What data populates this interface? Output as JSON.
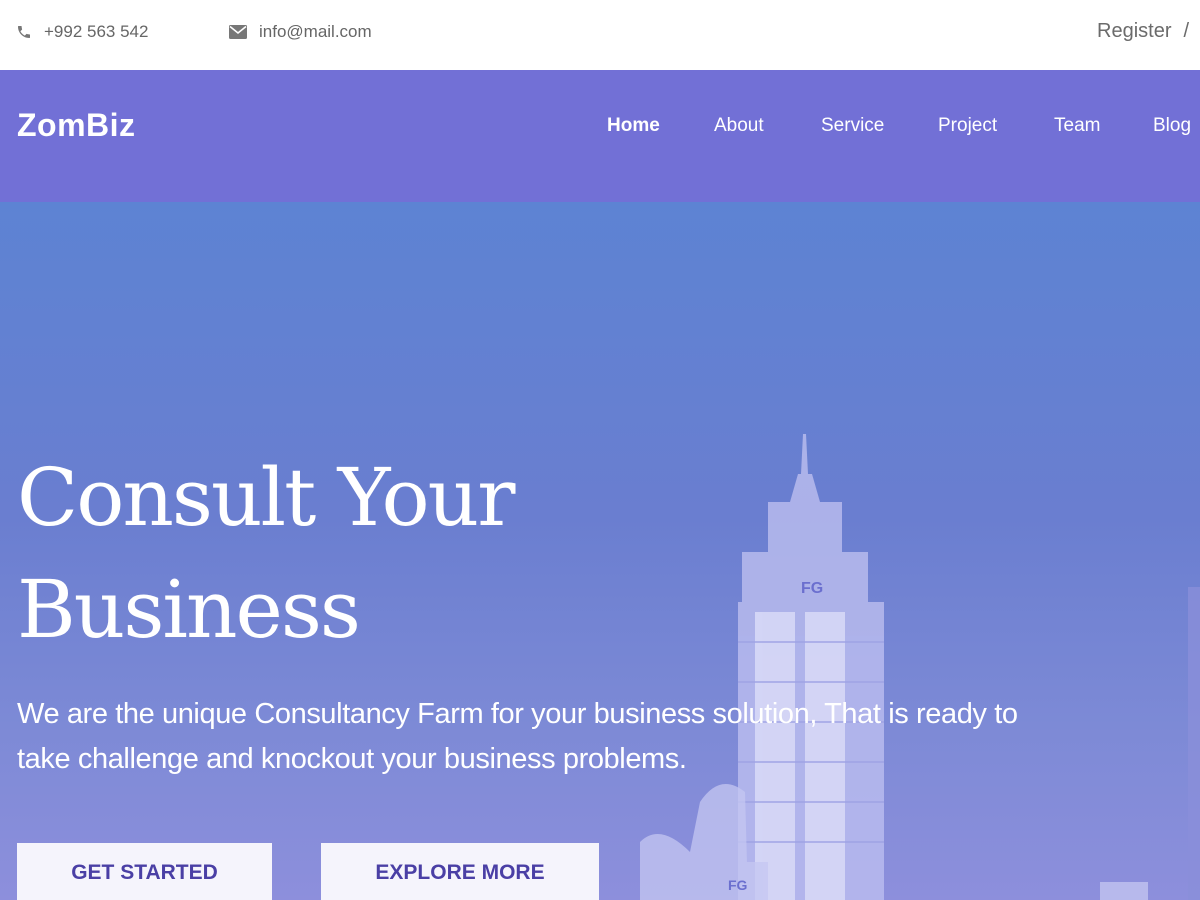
{
  "topbar": {
    "phone": "+992 563 542",
    "email": "info@mail.com",
    "register_label": "Register",
    "separator": "/"
  },
  "brand": {
    "logo": "ZomBiz",
    "nav_color": "#7270d6"
  },
  "nav": {
    "items": [
      {
        "label": "Home",
        "active": true
      },
      {
        "label": "About"
      },
      {
        "label": "Service"
      },
      {
        "label": "Project"
      },
      {
        "label": "Team"
      },
      {
        "label": "Blog"
      }
    ]
  },
  "hero": {
    "title_line1": "Consult Your",
    "title_line2": "Business",
    "description": "We are the unique Consultancy Farm for your business solution, That is ready to take challenge and knockout your business problems.",
    "primary_button": "GET STARTED",
    "secondary_button": "EXPLORE MORE",
    "building_sign": "FG"
  },
  "icons": {
    "phone": "phone-icon",
    "email": "envelope-icon"
  }
}
